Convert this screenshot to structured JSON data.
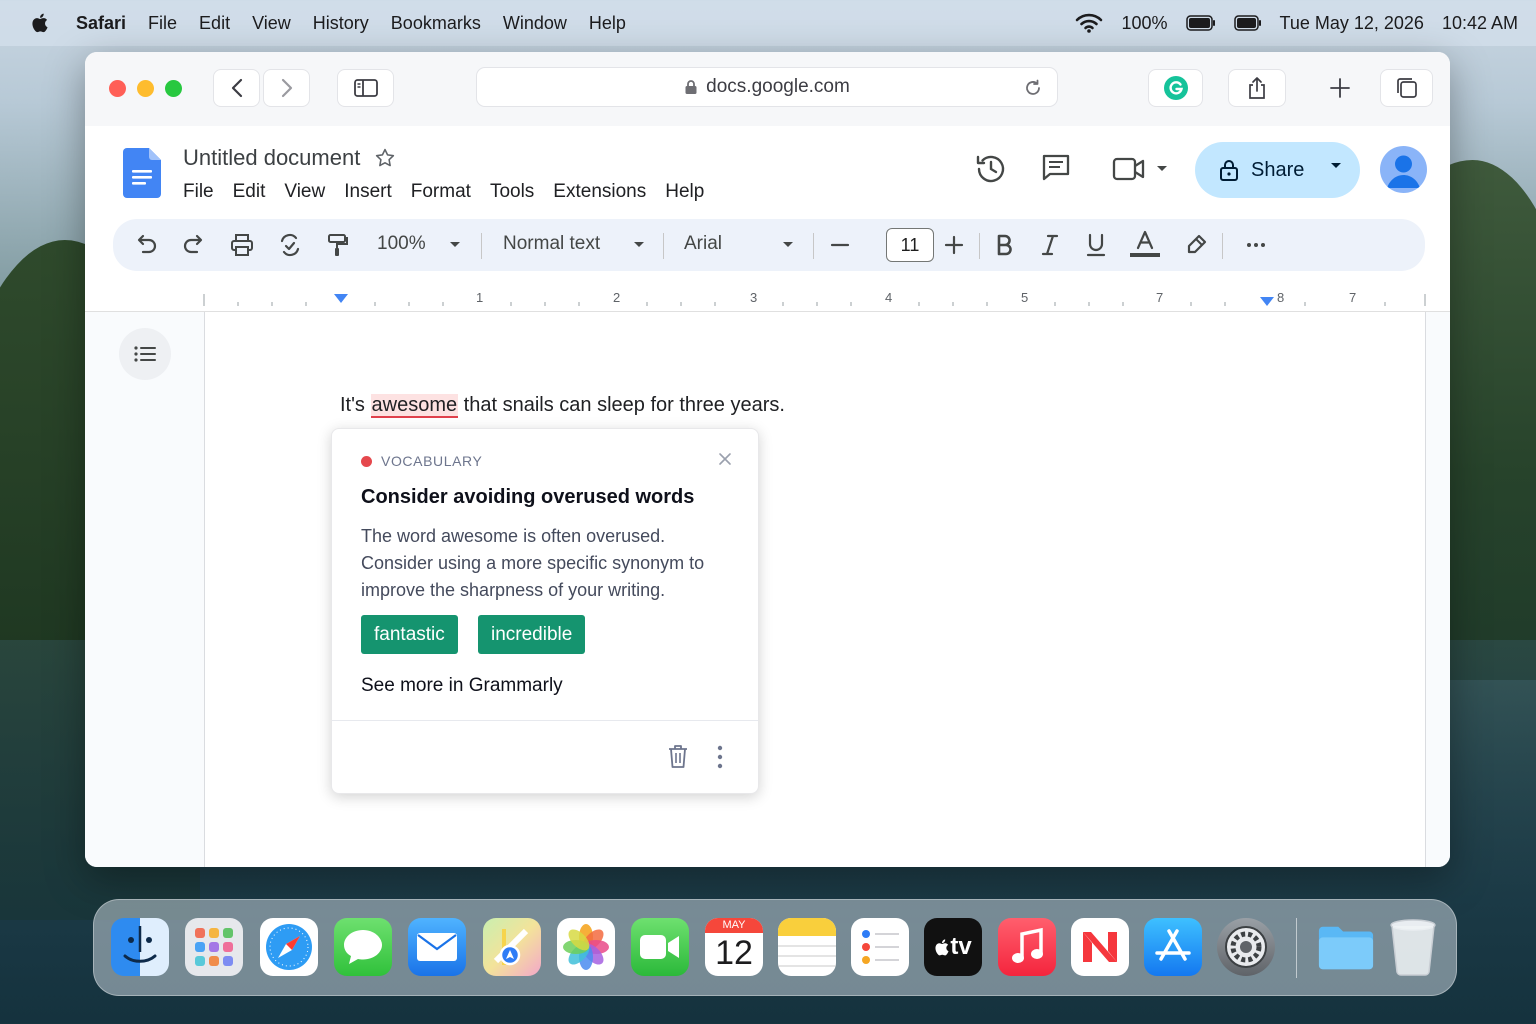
{
  "menubar": {
    "app": "Safari",
    "items": [
      "File",
      "Edit",
      "View",
      "History",
      "Bookmarks",
      "Window",
      "Help"
    ],
    "battery_percent": "100%",
    "date": "Tue May 12, 2026",
    "time": "10:42 AM"
  },
  "browser": {
    "url": "docs.google.com"
  },
  "docs": {
    "title": "Untitled document",
    "menu": [
      "File",
      "Edit",
      "View",
      "Insert",
      "Format",
      "Tools",
      "Extensions",
      "Help"
    ],
    "share_label": "Share",
    "toolbar": {
      "zoom": "100%",
      "style": "Normal text",
      "font": "Arial",
      "font_size": "11"
    },
    "ruler_numbers": [
      "1",
      "2",
      "3",
      "4",
      "5",
      "7",
      "8",
      "7"
    ],
    "body": {
      "before": "It's ",
      "flagged": "awesome",
      "after": " that snails can sleep for three years."
    }
  },
  "grammarly": {
    "category": "VOCABULARY",
    "heading": "Consider avoiding overused words",
    "description": "The word awesome is often overused. Consider using a more specific synonym to improve the sharpness of your writing.",
    "suggestions": [
      "fantastic",
      "incredible"
    ],
    "see_more": "See more in Grammarly",
    "accent_color": "#15946f",
    "flag_color": "#e5484d"
  },
  "dock": {
    "calendar_month": "MAY",
    "calendar_day": "12",
    "tv_label": "tv"
  }
}
